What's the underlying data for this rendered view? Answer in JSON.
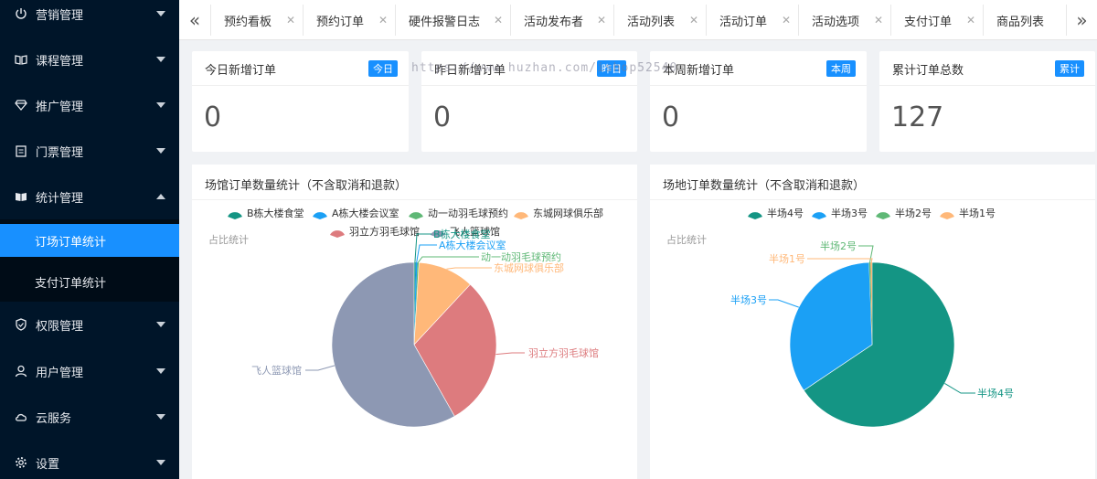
{
  "sidebar": {
    "items": [
      {
        "label": "营销管理",
        "icon": "power-icon",
        "expanded": false
      },
      {
        "label": "课程管理",
        "icon": "book-icon",
        "expanded": false
      },
      {
        "label": "推广管理",
        "icon": "diamond-icon",
        "expanded": false
      },
      {
        "label": "门票管理",
        "icon": "clipboard-icon",
        "expanded": false
      },
      {
        "label": "统计管理",
        "icon": "book-open-icon",
        "expanded": true
      },
      {
        "label": "权限管理",
        "icon": "shield-icon",
        "expanded": false
      },
      {
        "label": "用户管理",
        "icon": "user-icon",
        "expanded": false
      },
      {
        "label": "云服务",
        "icon": "cloud-icon",
        "expanded": false
      },
      {
        "label": "设置",
        "icon": "gear-icon",
        "expanded": false
      }
    ],
    "sub_items": [
      {
        "label": "订场订单统计",
        "active": true
      },
      {
        "label": "支付订单统计",
        "active": false
      }
    ]
  },
  "tabs": [
    {
      "label": "预约看板"
    },
    {
      "label": "预约订单"
    },
    {
      "label": "硬件报警日志"
    },
    {
      "label": "活动发布者"
    },
    {
      "label": "活动列表"
    },
    {
      "label": "活动订单"
    },
    {
      "label": "活动选项"
    },
    {
      "label": "支付订单"
    },
    {
      "label": "商品列表"
    }
  ],
  "stats": [
    {
      "title": "今日新增订单",
      "badge": "今日",
      "value": "0"
    },
    {
      "title": "昨日新增订单",
      "badge": "昨日",
      "value": "0"
    },
    {
      "title": "本周新增订单",
      "badge": "本周",
      "value": "0"
    },
    {
      "title": "累计订单总数",
      "badge": "累计",
      "value": "127"
    }
  ],
  "watermark": "https://www.huzhan.com/ishop52540",
  "colors": {
    "accent": "#1890ff",
    "sidebar_bg": "#001529",
    "teal": "#149584",
    "blue": "#1ba0f5",
    "green": "#5fb876",
    "orange": "#ffb879",
    "red": "#dd7b7e",
    "gray": "#8d98b3"
  },
  "chart_data": [
    {
      "type": "pie",
      "title": "场馆订单数量统计（不含取消和退款）",
      "subtitle": "占比统计",
      "legend_position": "top-center",
      "categories": [
        "B栋大楼食堂",
        "A栋大楼会议室",
        "动一动羽毛球预约",
        "东城网球俱乐部",
        "羽立方羽毛球馆",
        "飞人篮球馆"
      ],
      "values": [
        0.4,
        0.4,
        0.4,
        14,
        38,
        74
      ],
      "colors": [
        "#149584",
        "#1ba0f5",
        "#5fb876",
        "#ffb879",
        "#dd7b7e",
        "#8d98b3"
      ]
    },
    {
      "type": "pie",
      "title": "场地订单数量统计（不含取消和退款）",
      "subtitle": "占比统计",
      "legend_position": "top-center",
      "categories": [
        "半场4号",
        "半场3号",
        "半场2号",
        "半场1号"
      ],
      "values": [
        66,
        34,
        0.3,
        0.3
      ],
      "colors": [
        "#149584",
        "#1ba0f5",
        "#5fb876",
        "#ffb879"
      ]
    }
  ]
}
